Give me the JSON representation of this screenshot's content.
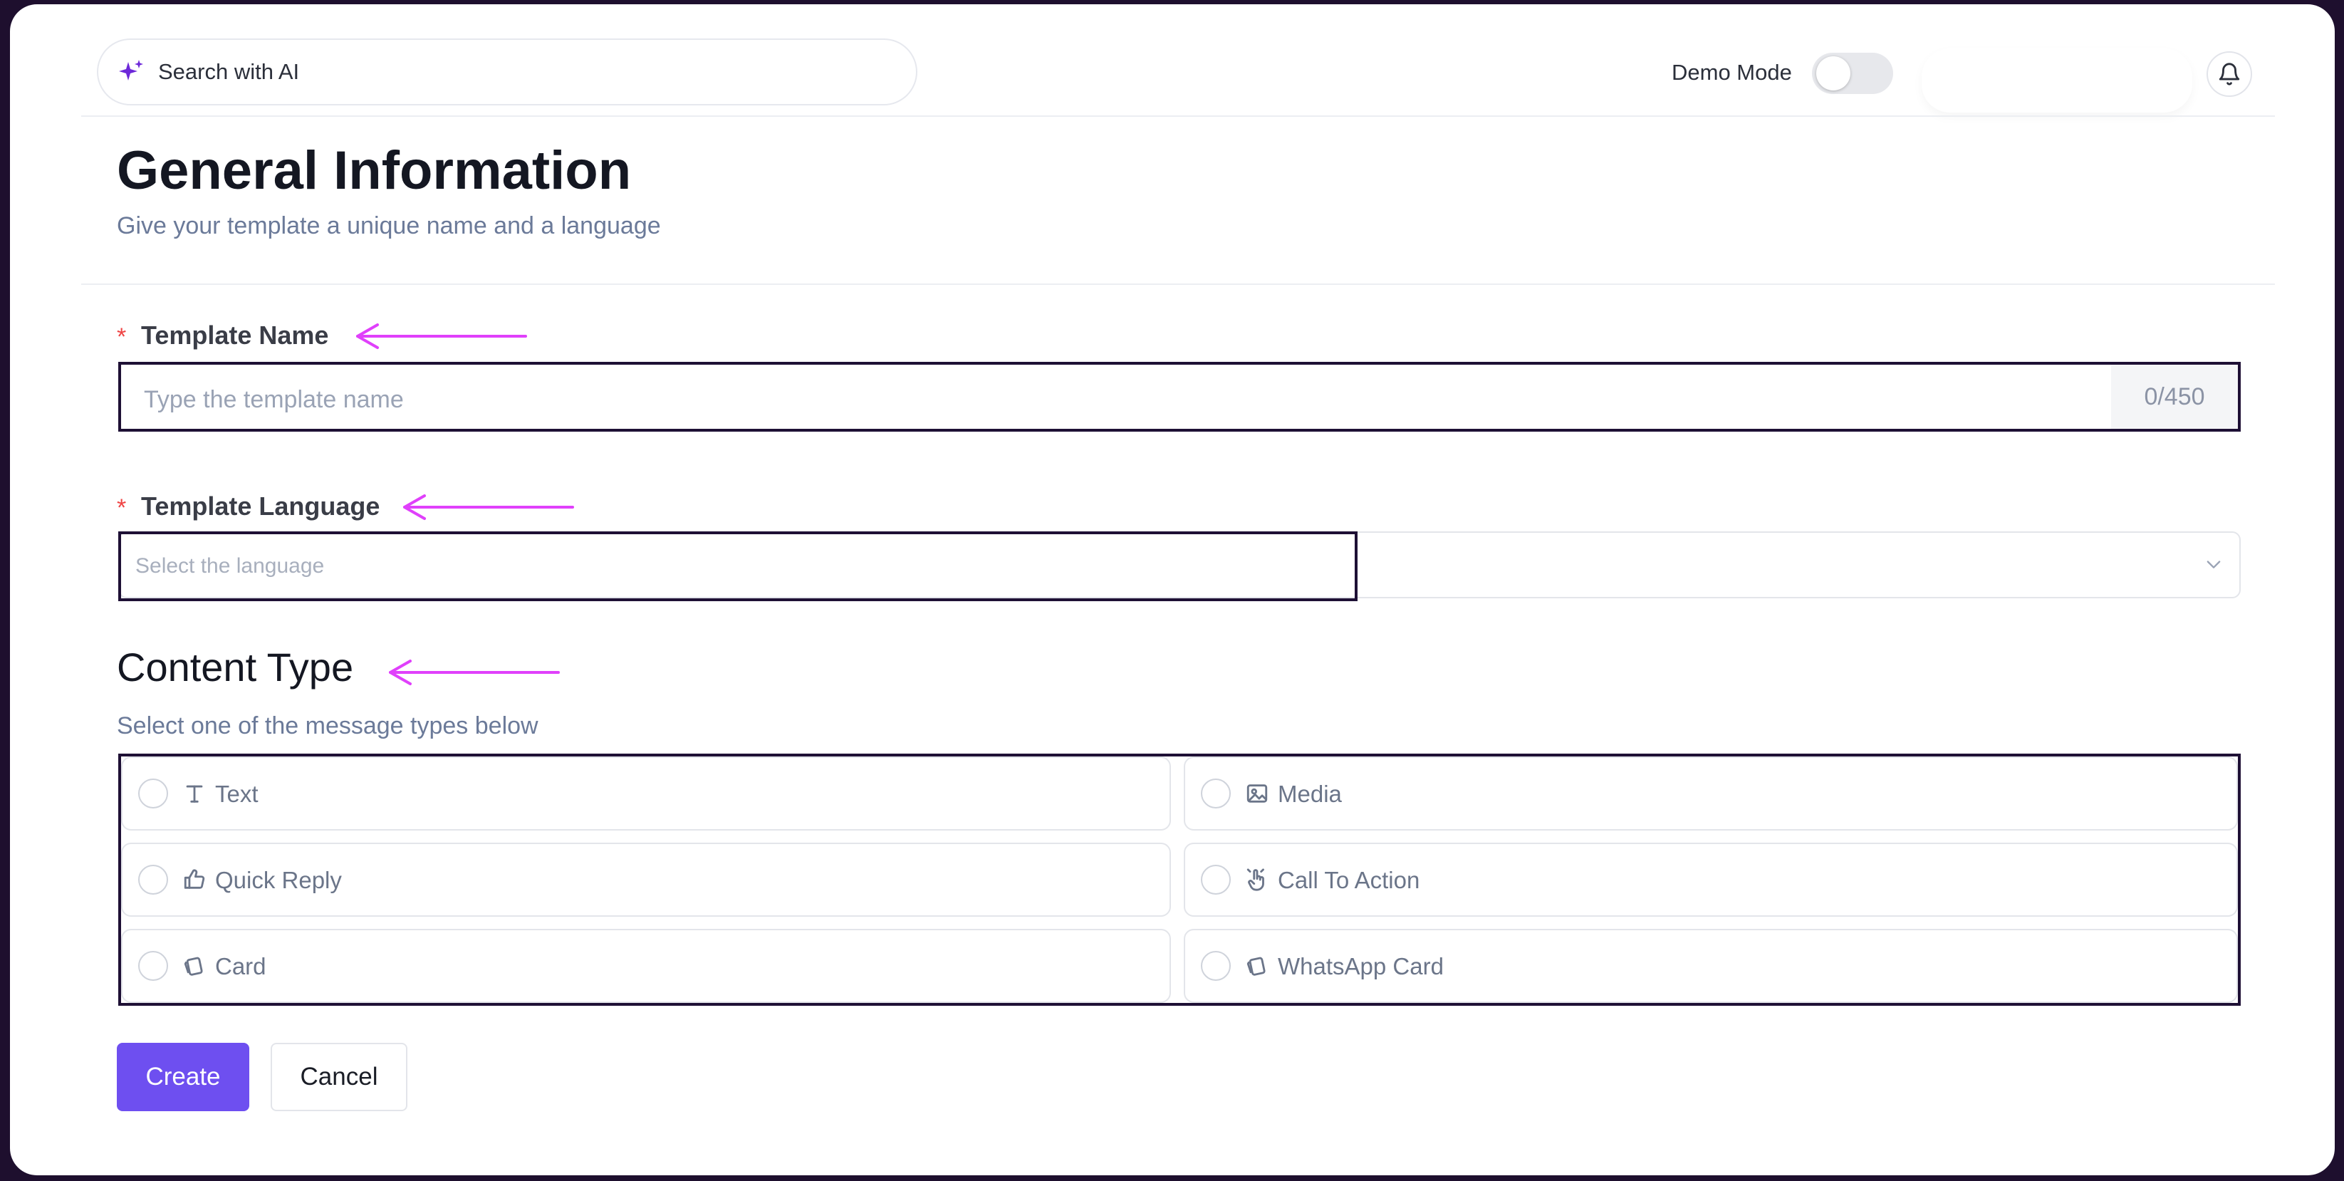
{
  "header": {
    "search_label": "Search with AI",
    "demo_mode_label": "Demo Mode",
    "demo_mode_on": false
  },
  "general": {
    "title": "General Information",
    "subtitle": "Give your template a unique name and a language"
  },
  "template_name": {
    "required_mark": "*",
    "label": "Template Name",
    "placeholder": "Type the template name",
    "counter": "0/450"
  },
  "template_language": {
    "required_mark": "*",
    "label": "Template Language",
    "placeholder": "Select the language"
  },
  "content_type": {
    "title": "Content Type",
    "subtitle": "Select one of the message types below",
    "options": [
      {
        "label": "Text",
        "icon": "text-icon"
      },
      {
        "label": "Media",
        "icon": "image-icon"
      },
      {
        "label": "Quick Reply",
        "icon": "thumbs-up-icon"
      },
      {
        "label": "Call To Action",
        "icon": "tap-hand-icon"
      },
      {
        "label": "Card",
        "icon": "cards-icon"
      },
      {
        "label": "WhatsApp Card",
        "icon": "cards-icon"
      }
    ]
  },
  "actions": {
    "create_label": "Create",
    "cancel_label": "Cancel"
  },
  "colors": {
    "accent": "#6e4ff0",
    "annotation_arrow": "#e040fb",
    "required": "#ef4444",
    "highlight_border": "#1e1035"
  }
}
